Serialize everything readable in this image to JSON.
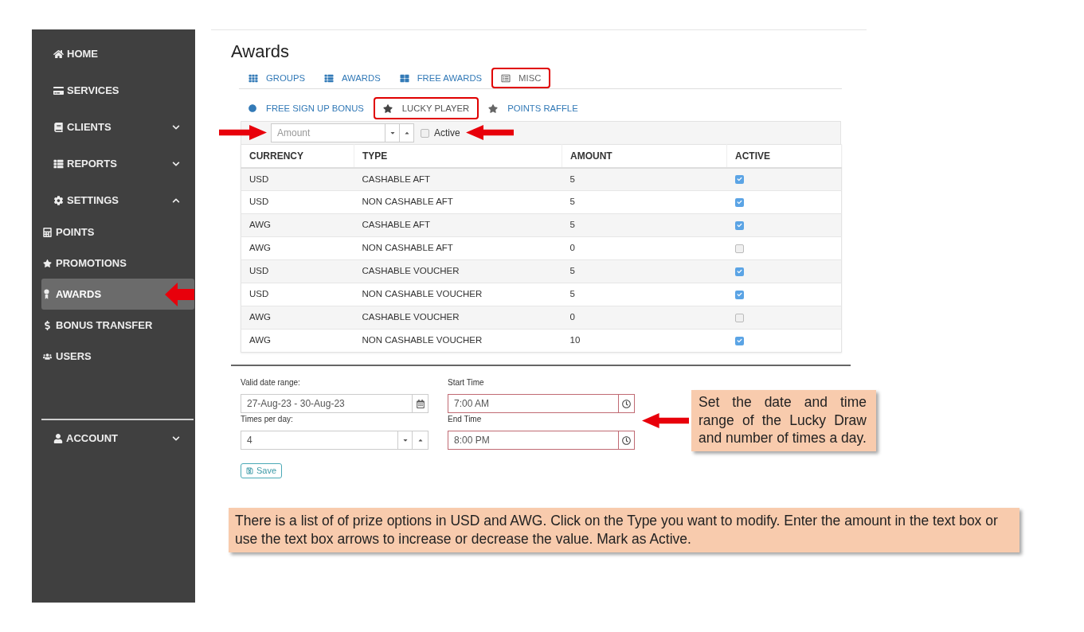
{
  "sidebar": {
    "items": [
      {
        "label": "HOME",
        "selected": false
      },
      {
        "label": "SERVICES",
        "selected": false
      },
      {
        "label": "CLIENTS",
        "selected": false,
        "expanded": false
      },
      {
        "label": "REPORTS",
        "selected": false,
        "expanded": false
      },
      {
        "label": "SETTINGS",
        "selected": false,
        "expanded": true,
        "children": [
          {
            "label": "POINTS",
            "selected": false
          },
          {
            "label": "PROMOTIONS",
            "selected": false
          },
          {
            "label": "AWARDS",
            "selected": true
          },
          {
            "label": "BONUS TRANSFER",
            "selected": false
          },
          {
            "label": "USERS",
            "selected": false
          }
        ]
      }
    ],
    "account": {
      "label": "ACCOUNT",
      "expanded": false
    }
  },
  "page_title": "Awards",
  "tabs": [
    {
      "label": "GROUPS",
      "selected": false,
      "highlighted": false
    },
    {
      "label": "AWARDS",
      "selected": false,
      "highlighted": false
    },
    {
      "label": "FREE AWARDS",
      "selected": false,
      "highlighted": false
    },
    {
      "label": "MISC",
      "selected": true,
      "highlighted": true
    }
  ],
  "subtabs": [
    {
      "label": "FREE SIGN UP BONUS",
      "selected": false,
      "highlighted": false
    },
    {
      "label": "LUCKY PLAYER",
      "selected": true,
      "highlighted": true
    },
    {
      "label": "POINTS RAFFLE",
      "selected": false,
      "highlighted": false
    }
  ],
  "amount_field": {
    "placeholder": "Amount"
  },
  "active_filter": {
    "label": "Active",
    "checked": false
  },
  "table": {
    "columns": [
      "CURRENCY",
      "TYPE",
      "AMOUNT",
      "ACTIVE"
    ],
    "rows": [
      {
        "currency": "USD",
        "type": "CASHABLE AFT",
        "amount": "5",
        "active": true
      },
      {
        "currency": "USD",
        "type": "NON CASHABLE AFT",
        "amount": "5",
        "active": true
      },
      {
        "currency": "AWG",
        "type": "CASHABLE AFT",
        "amount": "5",
        "active": true
      },
      {
        "currency": "AWG",
        "type": "NON CASHABLE AFT",
        "amount": "0",
        "active": false
      },
      {
        "currency": "USD",
        "type": "CASHABLE VOUCHER",
        "amount": "5",
        "active": true
      },
      {
        "currency": "USD",
        "type": "NON CASHABLE VOUCHER",
        "amount": "5",
        "active": true
      },
      {
        "currency": "AWG",
        "type": "CASHABLE VOUCHER",
        "amount": "0",
        "active": false
      },
      {
        "currency": "AWG",
        "type": "NON CASHABLE VOUCHER",
        "amount": "10",
        "active": true
      }
    ]
  },
  "schedule": {
    "fields": [
      {
        "kind": "date",
        "label": "Valid date range:",
        "value": "27-Aug-23 - 30-Aug-23",
        "invalid": false
      },
      {
        "kind": "time",
        "label": "Start Time",
        "value": "7:00 AM",
        "invalid": true
      },
      {
        "kind": "number",
        "label": "Times per day:",
        "value": "4",
        "invalid": false
      },
      {
        "kind": "time",
        "label": "End Time",
        "value": "8:00 PM",
        "invalid": true
      }
    ],
    "save_button": "Save"
  },
  "callouts": [
    {
      "text": "Set the date and time range of the Lucky Draw and number of times a day."
    },
    {
      "text": "There is a list of of prize options in USD and AWG. Click on the Type you want to modify. Enter the amount in the text box or use the text box arrows to increase or decrease the value. Mark as Active."
    }
  ]
}
